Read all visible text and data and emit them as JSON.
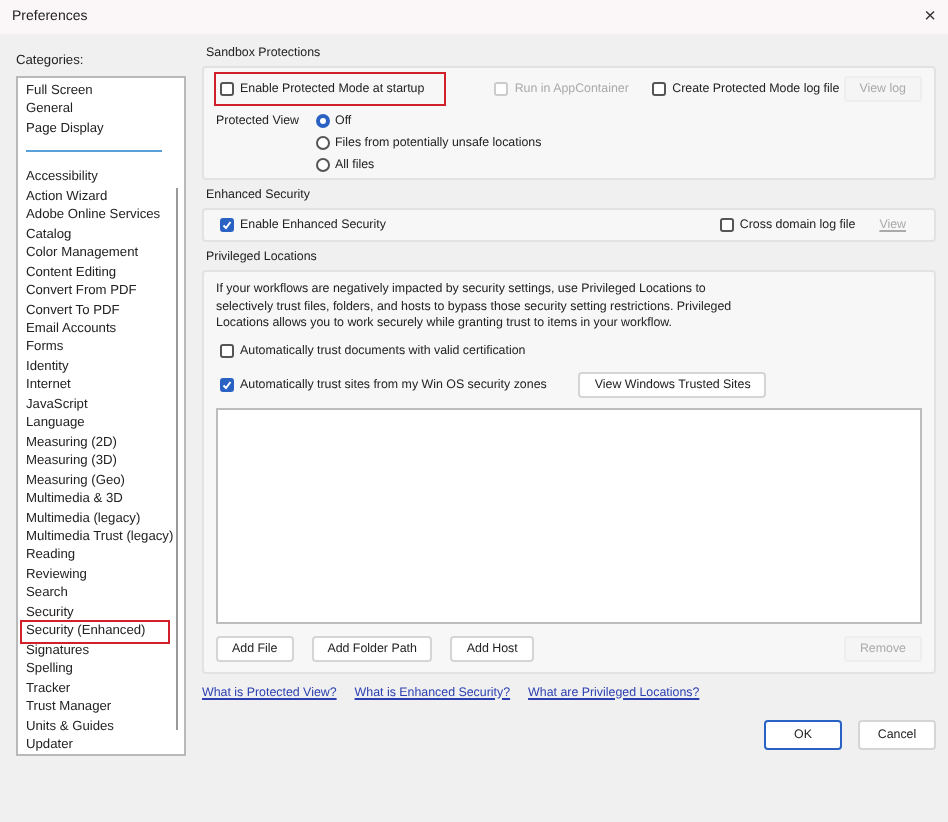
{
  "window": {
    "title": "Preferences",
    "close": "×"
  },
  "categories": {
    "label": "Categories:",
    "top_items": [
      {
        "label": "Full Screen",
        "highlighted": false
      },
      {
        "label": "General",
        "highlighted": false
      },
      {
        "label": "Page Display",
        "highlighted": false
      }
    ],
    "items": [
      {
        "label": "Accessibility",
        "highlighted": false
      },
      {
        "label": "Action Wizard",
        "highlighted": false
      },
      {
        "label": "Adobe Online Services",
        "highlighted": false
      },
      {
        "label": "Catalog",
        "highlighted": false
      },
      {
        "label": "Color Management",
        "highlighted": false
      },
      {
        "label": "Content Editing",
        "highlighted": false
      },
      {
        "label": "Convert From PDF",
        "highlighted": false
      },
      {
        "label": "Convert To PDF",
        "highlighted": false
      },
      {
        "label": "Email Accounts",
        "highlighted": false
      },
      {
        "label": "Forms",
        "highlighted": false
      },
      {
        "label": "Identity",
        "highlighted": false
      },
      {
        "label": "Internet",
        "highlighted": false
      },
      {
        "label": "JavaScript",
        "highlighted": false
      },
      {
        "label": "Language",
        "highlighted": false
      },
      {
        "label": "Measuring (2D)",
        "highlighted": false
      },
      {
        "label": "Measuring (3D)",
        "highlighted": false
      },
      {
        "label": "Measuring (Geo)",
        "highlighted": false
      },
      {
        "label": "Multimedia & 3D",
        "highlighted": false
      },
      {
        "label": "Multimedia (legacy)",
        "highlighted": false
      },
      {
        "label": "Multimedia Trust (legacy)",
        "highlighted": false
      },
      {
        "label": "Reading",
        "highlighted": false
      },
      {
        "label": "Reviewing",
        "highlighted": false
      },
      {
        "label": "Search",
        "highlighted": false
      },
      {
        "label": "Security",
        "highlighted": false
      },
      {
        "label": "Security (Enhanced)",
        "highlighted": true
      },
      {
        "label": "Signatures",
        "highlighted": false
      },
      {
        "label": "Spelling",
        "highlighted": false
      },
      {
        "label": "Tracker",
        "highlighted": false
      },
      {
        "label": "Trust Manager",
        "highlighted": false
      },
      {
        "label": "Units & Guides",
        "highlighted": false
      },
      {
        "label": "Updater",
        "highlighted": false
      }
    ]
  },
  "sandbox": {
    "title": "Sandbox Protections",
    "options": [
      {
        "label": "Enable Protected Mode at startup",
        "checked": false,
        "disabled": false,
        "highlighted": true
      },
      {
        "label": "Run in AppContainer",
        "checked": false,
        "disabled": true,
        "highlighted": false
      },
      {
        "label": "Create Protected Mode log file",
        "checked": false,
        "disabled": false,
        "highlighted": false
      }
    ],
    "view_log": {
      "label": "View log",
      "disabled": true
    },
    "protected_view": {
      "label": "Protected View",
      "options": [
        {
          "label": "Off",
          "selected": true
        },
        {
          "label": "Files from potentially unsafe locations",
          "selected": false
        },
        {
          "label": "All files",
          "selected": false
        }
      ]
    }
  },
  "enhanced": {
    "title": "Enhanced Security",
    "enable": {
      "label": "Enable Enhanced Security",
      "checked": true
    },
    "cross_domain": {
      "label": "Cross domain log file",
      "checked": false
    },
    "view": {
      "label": "View",
      "disabled": true
    }
  },
  "privileged": {
    "title": "Privileged Locations",
    "description": "If your workflows are negatively impacted by security settings, use Privileged Locations to selectively trust files, folders, and hosts to bypass those security setting restrictions. Privileged Locations allows you to work securely while granting trust to items in your workflow.",
    "options": [
      {
        "label": "Automatically trust documents with valid certification",
        "checked": false
      },
      {
        "label": "Automatically trust sites from my Win OS security zones",
        "checked": true
      }
    ],
    "trusted_sites_button": "View Windows Trusted Sites",
    "buttons": [
      {
        "label": "Add File",
        "disabled": false
      },
      {
        "label": "Add Folder Path",
        "disabled": false
      },
      {
        "label": "Add Host",
        "disabled": false
      },
      {
        "label": "Remove",
        "disabled": true
      }
    ]
  },
  "links": [
    "What is Protected View?",
    "What is Enhanced Security?",
    "What are Privileged Locations?"
  ],
  "buttons": [
    {
      "label": "OK",
      "default": true
    },
    {
      "label": "Cancel",
      "default": false
    }
  ]
}
